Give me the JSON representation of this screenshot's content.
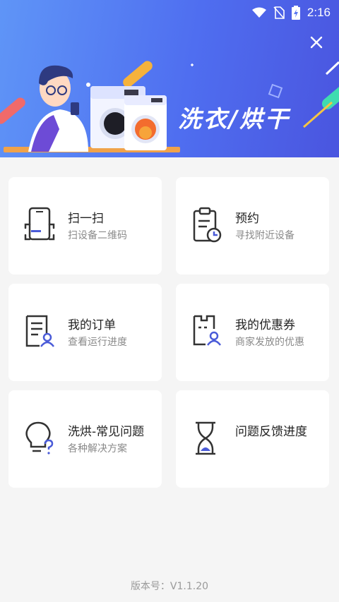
{
  "status_bar": {
    "time": "2:16"
  },
  "banner": {
    "title": "洗衣/烘干"
  },
  "cards": [
    {
      "title": "扫一扫",
      "subtitle": "扫设备二维码",
      "icon": "scan-phone-icon"
    },
    {
      "title": "预约",
      "subtitle": "寻找附近设备",
      "icon": "clipboard-clock-icon"
    },
    {
      "title": "我的订单",
      "subtitle": "查看运行进度",
      "icon": "order-document-icon"
    },
    {
      "title": "我的优惠券",
      "subtitle": "商家发放的优惠",
      "icon": "coupon-user-icon"
    },
    {
      "title": "洗烘-常见问题",
      "subtitle": "各种解决方案",
      "icon": "lightbulb-question-icon"
    },
    {
      "title": "问题反馈进度",
      "subtitle": "",
      "icon": "hourglass-icon"
    }
  ],
  "footer": {
    "version": "版本号：V1.1.20"
  },
  "colors": {
    "accent": "#4f6ef0",
    "icon_accent": "#4a5bd8"
  }
}
